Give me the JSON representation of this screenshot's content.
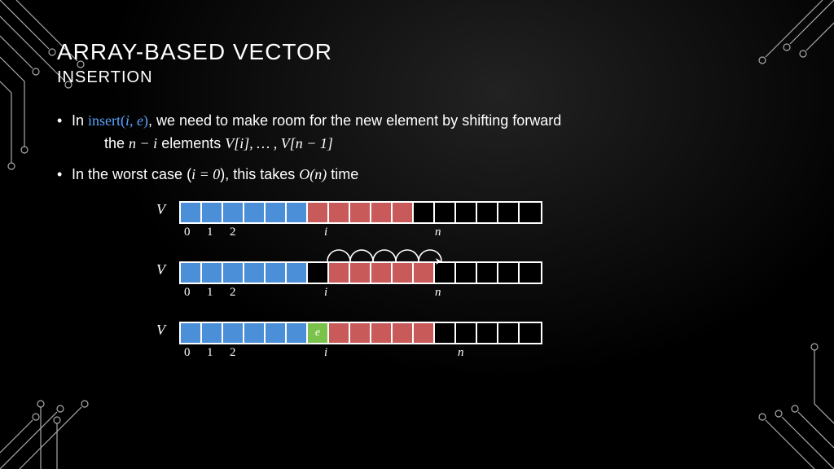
{
  "title": "ARRAY-BASED VECTOR",
  "subtitle": "INSERTION",
  "bullets": {
    "b1_pre": "In ",
    "b1_fn": "insert(",
    "b1_args": "i, e",
    "b1_fn_close": ")",
    "b1_post": ", we need to make room for the new element by shifting forward",
    "b1_line2_a": "the  ",
    "b1_m1": "n − i",
    "b1_line2_b": " elements ",
    "b1_m2": "V[i], … , V[n − 1]",
    "b2_a": "In the worst case (",
    "b2_m1": "i = 0",
    "b2_b": "), this takes ",
    "b2_m2": "O(n)",
    "b2_c": " time"
  },
  "arrays": {
    "label": "V",
    "row1": [
      "blue",
      "blue",
      "blue",
      "blue",
      "blue",
      "blue",
      "red",
      "red",
      "red",
      "red",
      "red",
      "black",
      "black",
      "black",
      "black",
      "black",
      "black"
    ],
    "row2": [
      "blue",
      "blue",
      "blue",
      "blue",
      "blue",
      "blue",
      "black",
      "red",
      "red",
      "red",
      "red",
      "red",
      "black",
      "black",
      "black",
      "black",
      "black"
    ],
    "row3": [
      "blue",
      "blue",
      "blue",
      "blue",
      "blue",
      "blue",
      "green",
      "red",
      "red",
      "red",
      "red",
      "red",
      "black",
      "black",
      "black",
      "black",
      "black"
    ],
    "green_label": "e",
    "indices": {
      "zero": "0",
      "one": "1",
      "two": "2",
      "i": "i",
      "n": "n"
    },
    "i_col": 6,
    "n_col_a": 11,
    "n_col_b": 12
  }
}
